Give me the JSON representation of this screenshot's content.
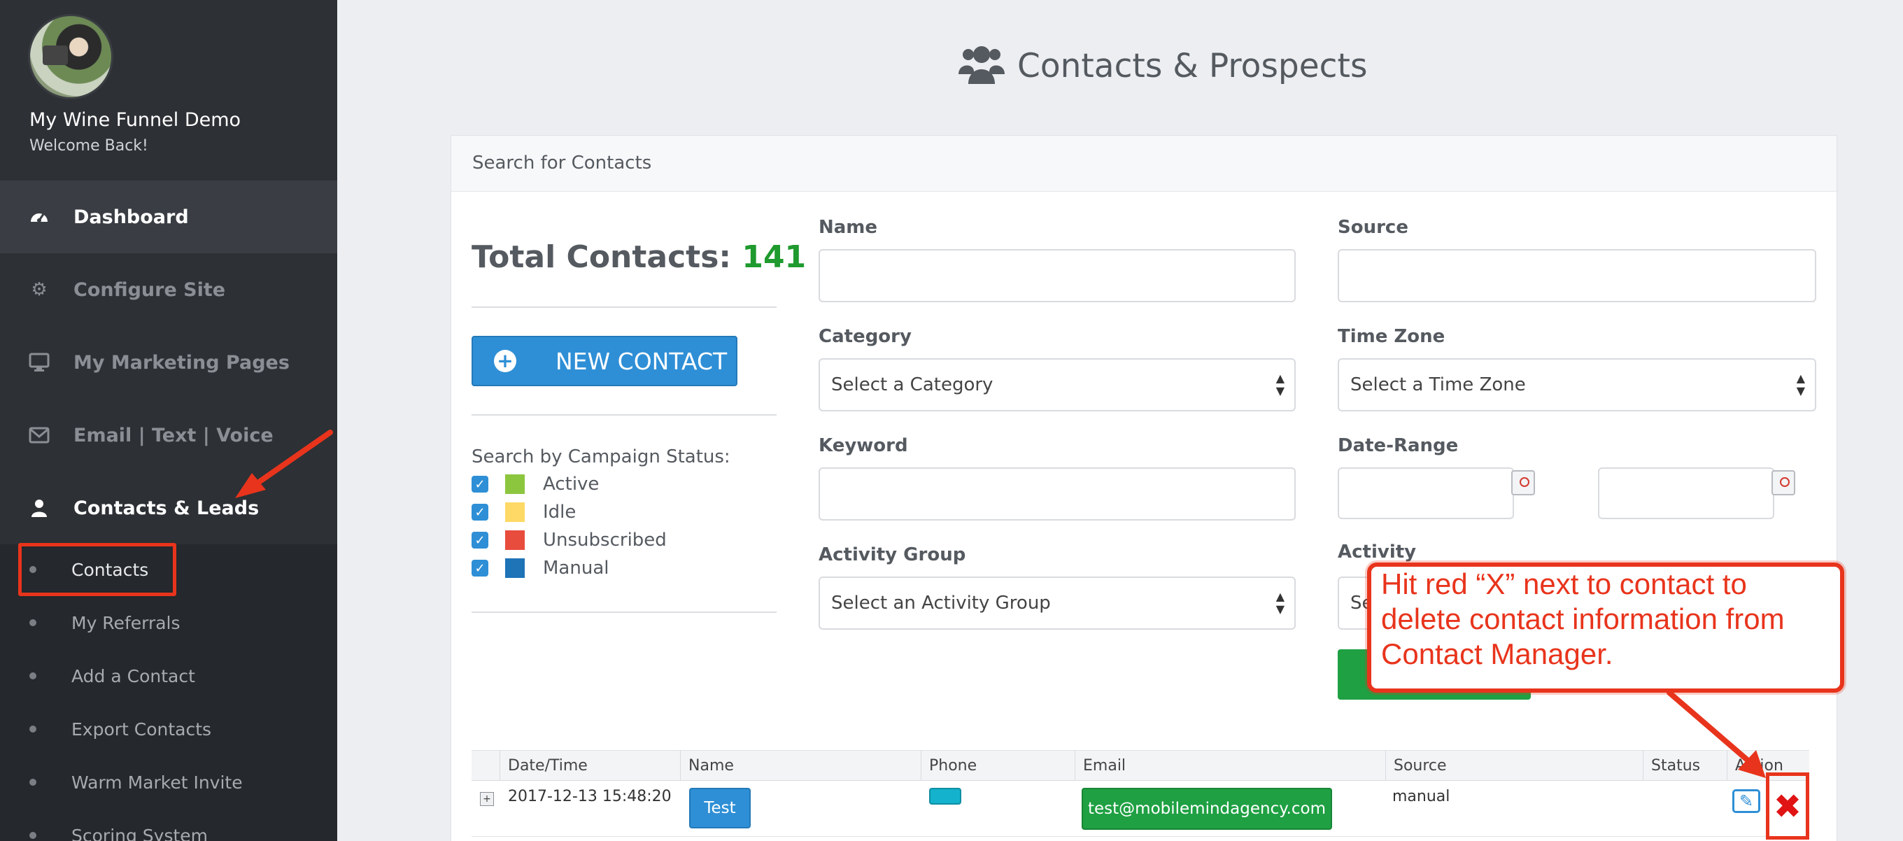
{
  "profile": {
    "site_name": "My Wine Funnel Demo",
    "welcome": "Welcome Back!"
  },
  "nav": {
    "dashboard": "Dashboard",
    "configure": "Configure Site",
    "marketing": "My Marketing Pages",
    "email": "Email | Text | Voice",
    "contacts": "Contacts & Leads"
  },
  "subnav": {
    "contacts": "Contacts",
    "referrals": "My Referrals",
    "add": "Add a Contact",
    "export": "Export Contacts",
    "warm": "Warm Market Invite",
    "scoring": "Scoring System"
  },
  "header": {
    "title": "Contacts & Prospects"
  },
  "search": {
    "title": "Search for Contacts",
    "total_label": "Total Contacts:",
    "total_count": "141",
    "new_contact": "NEW CONTACT",
    "status_title": "Search by Campaign Status:",
    "statuses": [
      {
        "label": "Active",
        "color": "#8cc63f"
      },
      {
        "label": "Idle",
        "color": "#ffd966"
      },
      {
        "label": "Unsubscribed",
        "color": "#e84c3d"
      },
      {
        "label": "Manual",
        "color": "#1f73b7"
      }
    ],
    "fields": {
      "name_label": "Name",
      "source_label": "Source",
      "category_label": "Category",
      "category_value": "Select a Category",
      "timezone_label": "Time Zone",
      "timezone_value": "Select a Time Zone",
      "keyword_label": "Keyword",
      "daterange_label": "Date-Range",
      "activity_group_label": "Activity Group",
      "activity_group_value": "Select an Activity Group",
      "activity_label": "Activity",
      "activity_value": "Se"
    }
  },
  "table": {
    "headers": [
      "Date/Time",
      "Name",
      "Phone",
      "Email",
      "Source",
      "Status",
      "Action"
    ],
    "rows": [
      {
        "datetime": "2017-12-13 15:48:20",
        "name": "Test",
        "email": "test@mobilemindagency.com",
        "source": "manual"
      }
    ]
  },
  "annotation": {
    "text": "Hit red “X” next to contact to delete contact information from Contact Manager.",
    "color": "#e8341c"
  }
}
